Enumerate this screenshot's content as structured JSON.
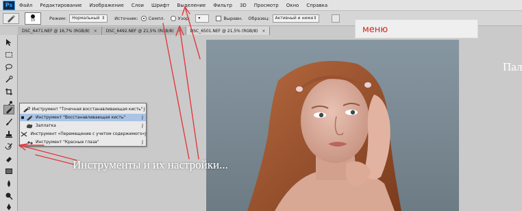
{
  "app": {
    "logo": "Ps",
    "menu": [
      "Файл",
      "Редактирование",
      "Изображение",
      "Слои",
      "Шрифт",
      "Выделение",
      "Фильтр",
      "3D",
      "Просмотр",
      "Окно",
      "Справка"
    ]
  },
  "options_bar": {
    "brush_size": "10",
    "mode_label": "Режим:",
    "mode_value": "Нормальный",
    "source_label": "Источник:",
    "sample_label": "Семпл.",
    "pattern_label": "Узор:",
    "align_label": "Выравн.",
    "sample_from_label": "Образец:",
    "sample_from_value": "Активный и ниже"
  },
  "tabs": [
    {
      "label": "DSC_6471.NEF @ 16,7% (RGB/8)",
      "close": "×"
    },
    {
      "label": "DSC_6492.NEF @ 21,5% (RGB/8)",
      "close": "×"
    },
    {
      "label": "DSC_6501.NEF @ 21,5% (RGB/8)",
      "close": "×"
    }
  ],
  "flyout": {
    "items": [
      {
        "label": "Инструмент \"Точечная восстанавливающая кисть\"",
        "key": "J",
        "selected": false,
        "icon": "spot-healing-icon"
      },
      {
        "label": "Инструмент \"Восстанавливающая кисть\"",
        "key": "J",
        "selected": true,
        "icon": "healing-brush-icon"
      },
      {
        "label": "Заплатка",
        "key": "J",
        "selected": false,
        "icon": "patch-icon"
      },
      {
        "label": "Инструмент «Перемещение с учетом содержимого»",
        "key": "J",
        "selected": false,
        "icon": "content-aware-move-icon"
      },
      {
        "label": "Инструмент \"Красные глаза\"",
        "key": "J",
        "selected": false,
        "icon": "red-eye-icon"
      }
    ]
  },
  "annotations": {
    "menu_label": "меню",
    "caption": "Инструменты и их настройки...",
    "cut_text": "Пал"
  },
  "colors": {
    "annotation_red": "#e0393e",
    "menu_label_red": "#d2261b",
    "selection_blue": "#a9c4e6"
  }
}
